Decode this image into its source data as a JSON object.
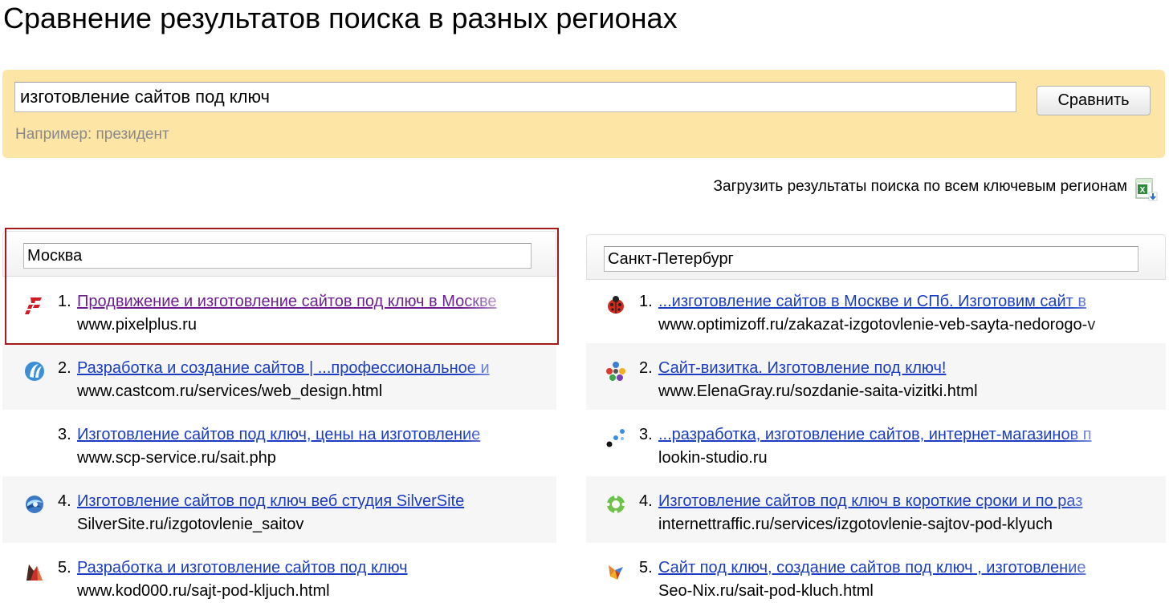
{
  "page": {
    "title": "Сравнение результатов поиска в разных регионах"
  },
  "search": {
    "query": "изготовление сайтов под ключ",
    "button_label": "Сравнить",
    "example": "Например: президент"
  },
  "download": {
    "label": "Загрузить результаты поиска по всем ключевым регионам",
    "icon": "excel-download-icon"
  },
  "colors": {
    "panel_background": "#fde5a5",
    "link": "#1a3dc1",
    "visited_link": "#6b1f8f",
    "highlight_border": "#a51a1a"
  },
  "regions": [
    {
      "name": "Москва",
      "results": [
        {
          "num": "1.",
          "title": "Продвижение и изготовление сайтов под ключ в Москве",
          "url": "www.pixelplus.ru",
          "icon": "pixelplus-favicon"
        },
        {
          "num": "2.",
          "title": "Разработка и создание сайтов | ...профессиональное и",
          "url": "www.castcom.ru/services/web_design.html",
          "icon": "castcom-favicon"
        },
        {
          "num": "3.",
          "title": "Изготовление сайтов под ключ, цены на изготовление",
          "url": "www.scp-service.ru/sait.php",
          "icon": ""
        },
        {
          "num": "4.",
          "title": "Изготовление сайтов под ключ веб студия SilverSite",
          "url": "SilverSite.ru/izgotovlenie_saitov",
          "icon": "silversite-favicon"
        },
        {
          "num": "5.",
          "title": "Разработка и изготовление сайтов под ключ",
          "url": "www.kod000.ru/sajt-pod-kljuch.html",
          "icon": "kod000-favicon"
        }
      ]
    },
    {
      "name": "Санкт-Петербург",
      "results": [
        {
          "num": "1.",
          "title": "...изготовление сайтов в Москве и СПб. Изготовим сайт в",
          "url": "www.optimizoff.ru/zakazat-izgotovlenie-veb-sayta-nedorogo-v",
          "icon": "ladybug-favicon"
        },
        {
          "num": "2.",
          "title": "Сайт-визитка. Изготовление под ключ!",
          "url": "www.ElenaGray.ru/sozdanie-saita-vizitki.html",
          "icon": "elenagray-favicon"
        },
        {
          "num": "3.",
          "title": "...разработка, изготовление сайтов, интернет-магазинов п",
          "url": "lookin-studio.ru",
          "icon": "lookin-favicon"
        },
        {
          "num": "4.",
          "title": "Изготовление сайтов под ключ в короткие сроки и по раз",
          "url": "internettraffic.ru/services/izgotovlenie-sajtov-pod-klyuch",
          "icon": "internettraffic-favicon"
        },
        {
          "num": "5.",
          "title": "Сайт под ключ, создание сайтов под ключ , изготовление",
          "url": "Seo-Nix.ru/sait-pod-kluch.html",
          "icon": "seonix-favicon"
        }
      ]
    }
  ]
}
